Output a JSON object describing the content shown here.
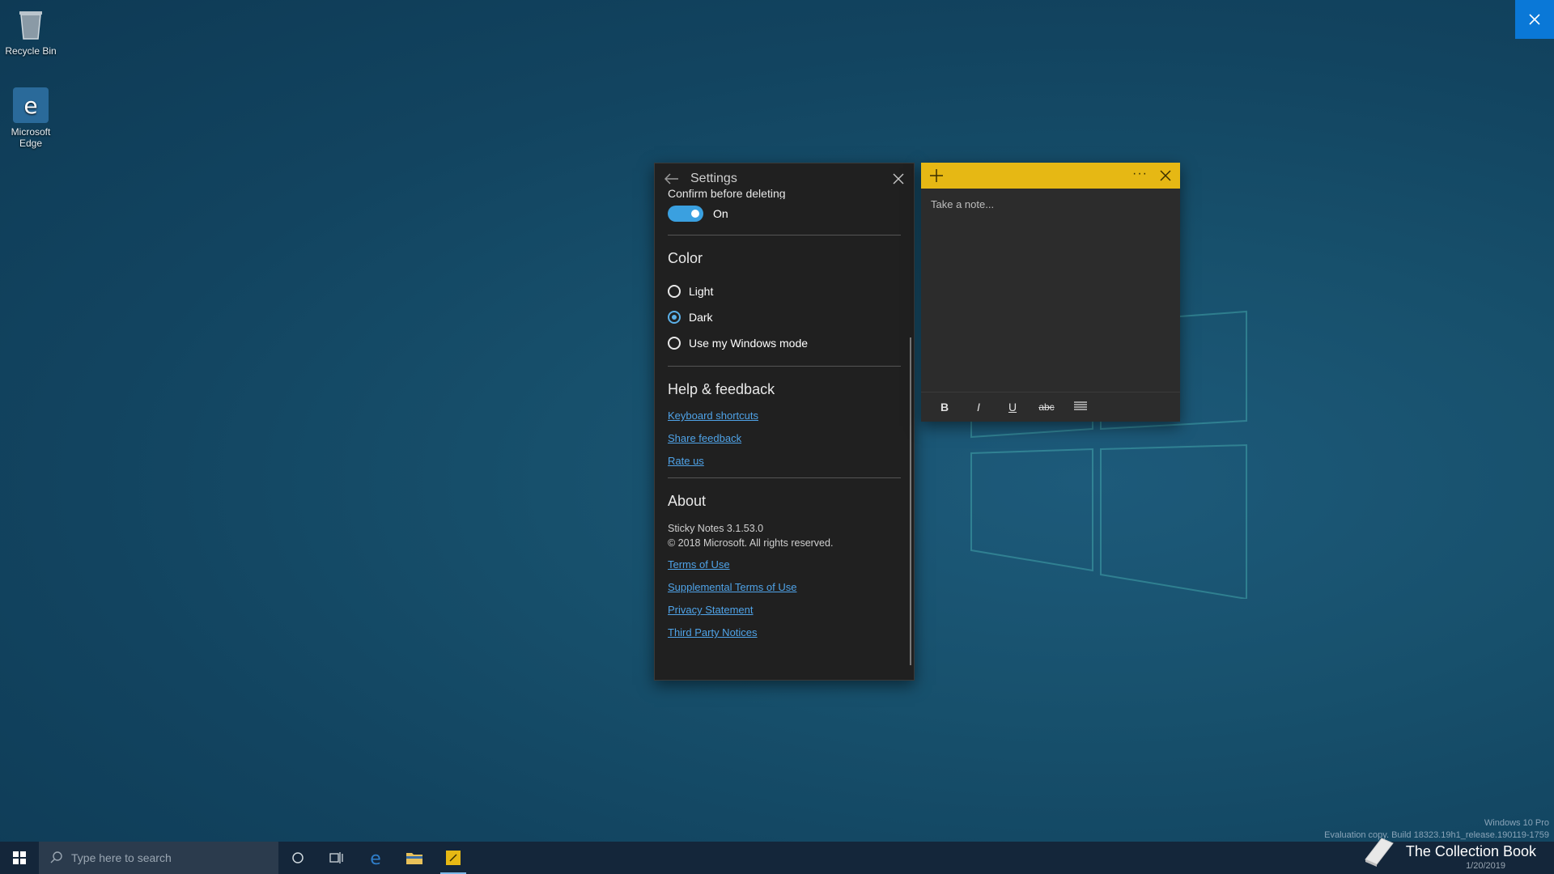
{
  "desktop": {
    "icons": [
      {
        "label": "Recycle Bin"
      },
      {
        "label": "Microsoft Edge"
      }
    ],
    "watermark_line1": "Windows 10 Pro",
    "watermark_line2": "Evaluation copy. Build 18323.19h1_release.190119-1759",
    "date": "1/20/2019"
  },
  "settings": {
    "title": "Settings",
    "confirm_label": "Confirm before deleting",
    "toggle_label": "On",
    "color_title": "Color",
    "color_options": [
      {
        "label": "Light",
        "checked": false
      },
      {
        "label": "Dark",
        "checked": true
      },
      {
        "label": "Use my Windows mode",
        "checked": false
      }
    ],
    "help_title": "Help & feedback",
    "help_links": [
      "Keyboard shortcuts",
      "Share feedback",
      "Rate us"
    ],
    "about_title": "About",
    "version": "Sticky Notes 3.1.53.0",
    "copyright": "© 2018 Microsoft. All rights reserved.",
    "about_links": [
      "Terms of Use",
      "Supplemental Terms of Use",
      "Privacy Statement",
      "Third Party Notices"
    ]
  },
  "note": {
    "placeholder": "Take a note...",
    "more": "···",
    "tools": {
      "bold": "B",
      "italic": "I",
      "underline": "U",
      "strike": "abc"
    }
  },
  "taskbar": {
    "search_placeholder": "Type here to search"
  },
  "branding": {
    "name": "The Collection Book"
  },
  "colors": {
    "accent": "#0a78d7",
    "note_yellow": "#e6b814",
    "link": "#4fa3e8"
  }
}
